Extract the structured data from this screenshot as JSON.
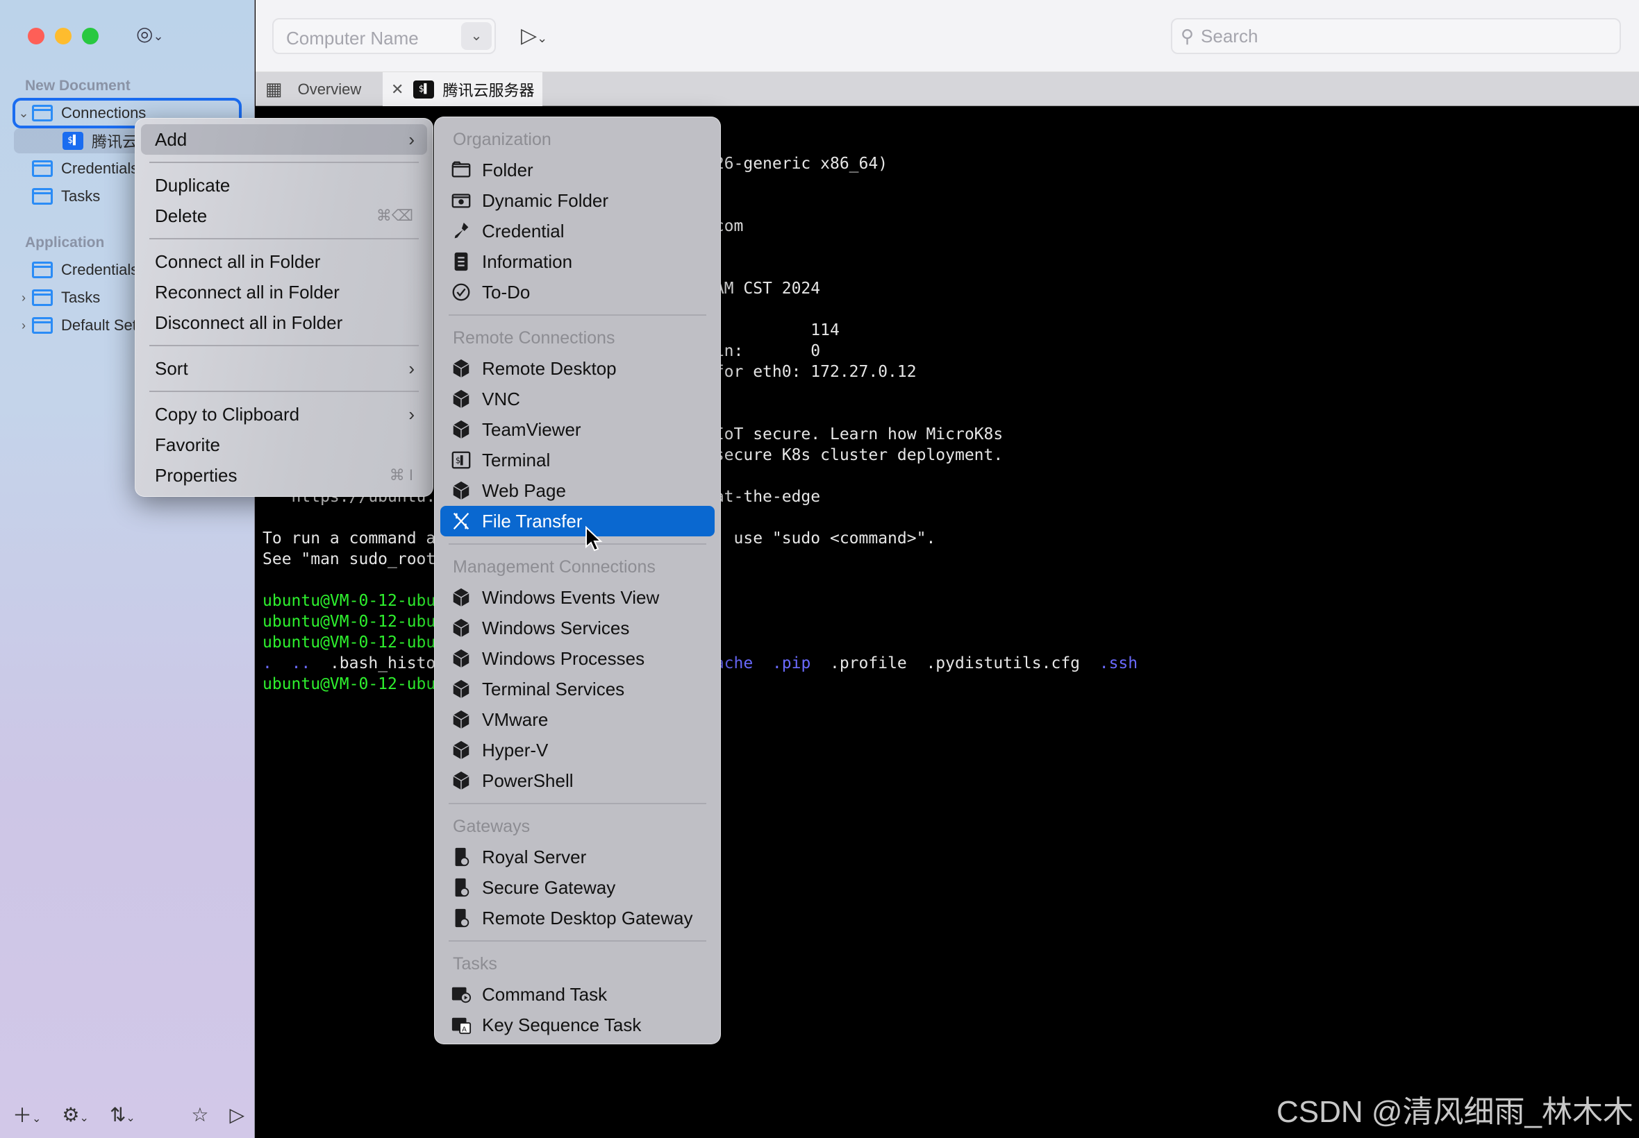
{
  "window": {
    "controls": [
      "close",
      "minimize",
      "zoom"
    ]
  },
  "sidebar": {
    "document_header": "New Document",
    "items": [
      {
        "label": "Connections",
        "icon": "folder-icon",
        "expanded": true,
        "selected": true
      },
      {
        "label": "腾讯云服务器",
        "icon": "terminal-icon",
        "child": true
      },
      {
        "label": "Credentials",
        "icon": "folder-icon"
      },
      {
        "label": "Tasks",
        "icon": "folder-icon"
      }
    ],
    "application_header": "Application",
    "app_items": [
      {
        "label": "Credentials",
        "icon": "folder-icon"
      },
      {
        "label": "Tasks",
        "icon": "folder-icon",
        "collapsed": true
      },
      {
        "label": "Default Settings",
        "icon": "folder-icon",
        "collapsed": true
      }
    ],
    "bottom": [
      "add-icon",
      "gear-icon",
      "sync-icon",
      "star-icon",
      "play-icon"
    ]
  },
  "toolbar": {
    "computer_name_placeholder": "Computer Name",
    "search_placeholder": "Search"
  },
  "tabs": [
    {
      "label": "Overview",
      "icon": "grid-icon"
    },
    {
      "label": "腾讯云服务器",
      "icon": "terminal-icon",
      "active": true
    }
  ],
  "terminal": {
    "lines": [
      {
        "l": [],
        "r": []
      },
      {
        "l": [],
        "r": []
      },
      {
        "l": [],
        "r": [
          {
            "t": "26-generic x86_64)",
            "c": "w"
          }
        ]
      },
      {
        "l": [],
        "r": []
      },
      {
        "l": [],
        "r": []
      },
      {
        "l": [],
        "r": [
          {
            "t": "com",
            "c": "w"
          }
        ]
      },
      {
        "l": [],
        "r": []
      },
      {
        "l": [],
        "r": []
      },
      {
        "l": [],
        "r": [
          {
            "t": "AM CST 2024",
            "c": "w"
          }
        ]
      },
      {
        "l": [],
        "r": []
      },
      {
        "l": [],
        "r": [
          {
            "t": "          114",
            "c": "w"
          }
        ]
      },
      {
        "l": [],
        "r": [
          {
            "t": "in:       0",
            "c": "w"
          }
        ]
      },
      {
        "l": [],
        "r": [
          {
            "t": "for eth0: 172.27.0.12",
            "c": "w"
          }
        ]
      },
      {
        "l": [],
        "r": []
      },
      {
        "l": [],
        "r": []
      },
      {
        "l": [],
        "r": [
          {
            "t": "IoT secure. Learn how MicroK8s",
            "c": "w"
          }
        ]
      },
      {
        "l": [],
        "r": [
          {
            "t": "secure K8s cluster deployment.",
            "c": "w"
          }
        ]
      },
      {
        "l": [],
        "r": []
      },
      {
        "l": [
          {
            "t": "   https://ubuntu.",
            "c": "w"
          }
        ],
        "r": [
          {
            "t": "at-the-edge",
            "c": "w"
          }
        ]
      },
      {
        "l": [],
        "r": []
      },
      {
        "l": [
          {
            "t": "To run a command a",
            "c": "w"
          }
        ],
        "r": [
          {
            "t": ", use \"sudo <command>\".",
            "c": "w"
          }
        ]
      },
      {
        "l": [
          {
            "t": "See \"man sudo_root",
            "c": "w"
          }
        ],
        "r": []
      },
      {
        "l": [],
        "r": []
      },
      {
        "l": [
          {
            "t": "ubuntu@VM-0-12-ubu",
            "c": "g"
          }
        ],
        "r": []
      },
      {
        "l": [
          {
            "t": "ubuntu@VM-0-12-ubu",
            "c": "g"
          }
        ],
        "r": []
      },
      {
        "l": [
          {
            "t": "ubuntu@VM-0-12-ubu",
            "c": "g"
          }
        ],
        "r": []
      },
      {
        "l": [
          {
            "t": ".",
            "c": "b"
          },
          {
            "t": "  ",
            "c": "w"
          },
          {
            "t": "..",
            "c": "b"
          },
          {
            "t": "  .bash_histo",
            "c": "w"
          }
        ],
        "r": [
          {
            "t": "ache",
            "c": "b"
          },
          {
            "t": "  ",
            "c": "w"
          },
          {
            "t": ".pip",
            "c": "b"
          },
          {
            "t": "  .profile  .pydistutils.cfg  ",
            "c": "w"
          },
          {
            "t": ".ssh",
            "c": "b"
          }
        ]
      },
      {
        "l": [
          {
            "t": "ubuntu@VM-0-12-ubu",
            "c": "g"
          }
        ],
        "r": []
      }
    ],
    "colors": {
      "w": "#e6e6e6",
      "g": "#2ef02e",
      "b": "#6a6aff"
    }
  },
  "context_menu": [
    {
      "label": "Add",
      "submenu": true,
      "hover": true
    },
    {
      "sep": true
    },
    {
      "label": "Duplicate"
    },
    {
      "label": "Delete",
      "shortcut": "⌘⌫"
    },
    {
      "sep": true
    },
    {
      "label": "Connect all in Folder"
    },
    {
      "label": "Reconnect all in Folder"
    },
    {
      "label": "Disconnect all in Folder"
    },
    {
      "sep": true
    },
    {
      "label": "Sort",
      "submenu": true
    },
    {
      "sep": true
    },
    {
      "label": "Copy to Clipboard",
      "submenu": true
    },
    {
      "label": "Favorite"
    },
    {
      "label": "Properties",
      "shortcut": "⌘ I"
    }
  ],
  "add_submenu": [
    {
      "header": "Organization"
    },
    {
      "label": "Folder",
      "icon": "folder"
    },
    {
      "label": "Dynamic Folder",
      "icon": "dynamic-folder"
    },
    {
      "label": "Credential",
      "icon": "key"
    },
    {
      "label": "Information",
      "icon": "info"
    },
    {
      "label": "To-Do",
      "icon": "check"
    },
    {
      "sep": true
    },
    {
      "header": "Remote Connections"
    },
    {
      "label": "Remote Desktop",
      "icon": "cube"
    },
    {
      "label": "VNC",
      "icon": "cube"
    },
    {
      "label": "TeamViewer",
      "icon": "cube"
    },
    {
      "label": "Terminal",
      "icon": "terminal"
    },
    {
      "label": "Web Page",
      "icon": "cube"
    },
    {
      "label": "File Transfer",
      "icon": "file-transfer",
      "active": true
    },
    {
      "sep": true
    },
    {
      "header": "Management Connections"
    },
    {
      "label": "Windows Events View",
      "icon": "cube"
    },
    {
      "label": "Windows Services",
      "icon": "cube"
    },
    {
      "label": "Windows Processes",
      "icon": "cube"
    },
    {
      "label": "Terminal Services",
      "icon": "cube"
    },
    {
      "label": "VMware",
      "icon": "cube"
    },
    {
      "label": "Hyper-V",
      "icon": "cube"
    },
    {
      "label": "PowerShell",
      "icon": "cube"
    },
    {
      "sep": true
    },
    {
      "header": "Gateways"
    },
    {
      "label": "Royal Server",
      "icon": "server"
    },
    {
      "label": "Secure Gateway",
      "icon": "server"
    },
    {
      "label": "Remote Desktop Gateway",
      "icon": "server"
    },
    {
      "sep": true
    },
    {
      "header": "Tasks"
    },
    {
      "label": "Command Task",
      "icon": "command"
    },
    {
      "label": "Key Sequence Task",
      "icon": "keyseq"
    }
  ],
  "watermark": "CSDN @清风细雨_林木木"
}
